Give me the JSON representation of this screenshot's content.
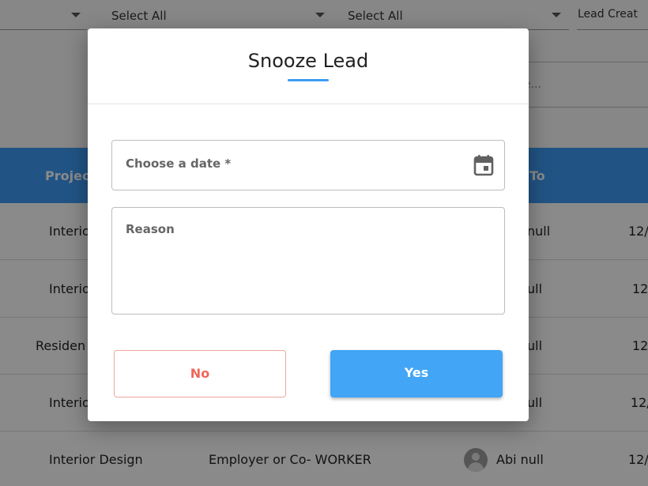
{
  "filters": {
    "select_1": "Select All",
    "select_2": "Select All",
    "date_filter": "Lead Creat",
    "search_placeholder_fragment": "e..."
  },
  "table": {
    "headers": [
      "Projec",
      "To"
    ],
    "rows": [
      {
        "project": "Interio",
        "assigned": "null",
        "date": "12/"
      },
      {
        "project": "Interio",
        "assigned": "ull",
        "date": "12/"
      },
      {
        "project": "Residen",
        "assigned": "ull",
        "date": "12/"
      },
      {
        "project": "Interio",
        "assigned": "ull",
        "date": "12/"
      },
      {
        "project": "Interior Design",
        "client_type": "Employer or Co- WORKER",
        "assigned": "Abi null",
        "date": "12/"
      }
    ]
  },
  "modal": {
    "title": "Snooze Lead",
    "date_label": "Choose a date *",
    "reason_label": "Reason",
    "no_label": "No",
    "yes_label": "Yes"
  },
  "colors": {
    "accent": "#3d9bf5",
    "yes_button": "#42a5f5",
    "no_text": "#f0655a",
    "no_border": "#f0a59f"
  },
  "icons": {
    "date_field": "calendar-icon",
    "assignee": "avatar-icon"
  }
}
